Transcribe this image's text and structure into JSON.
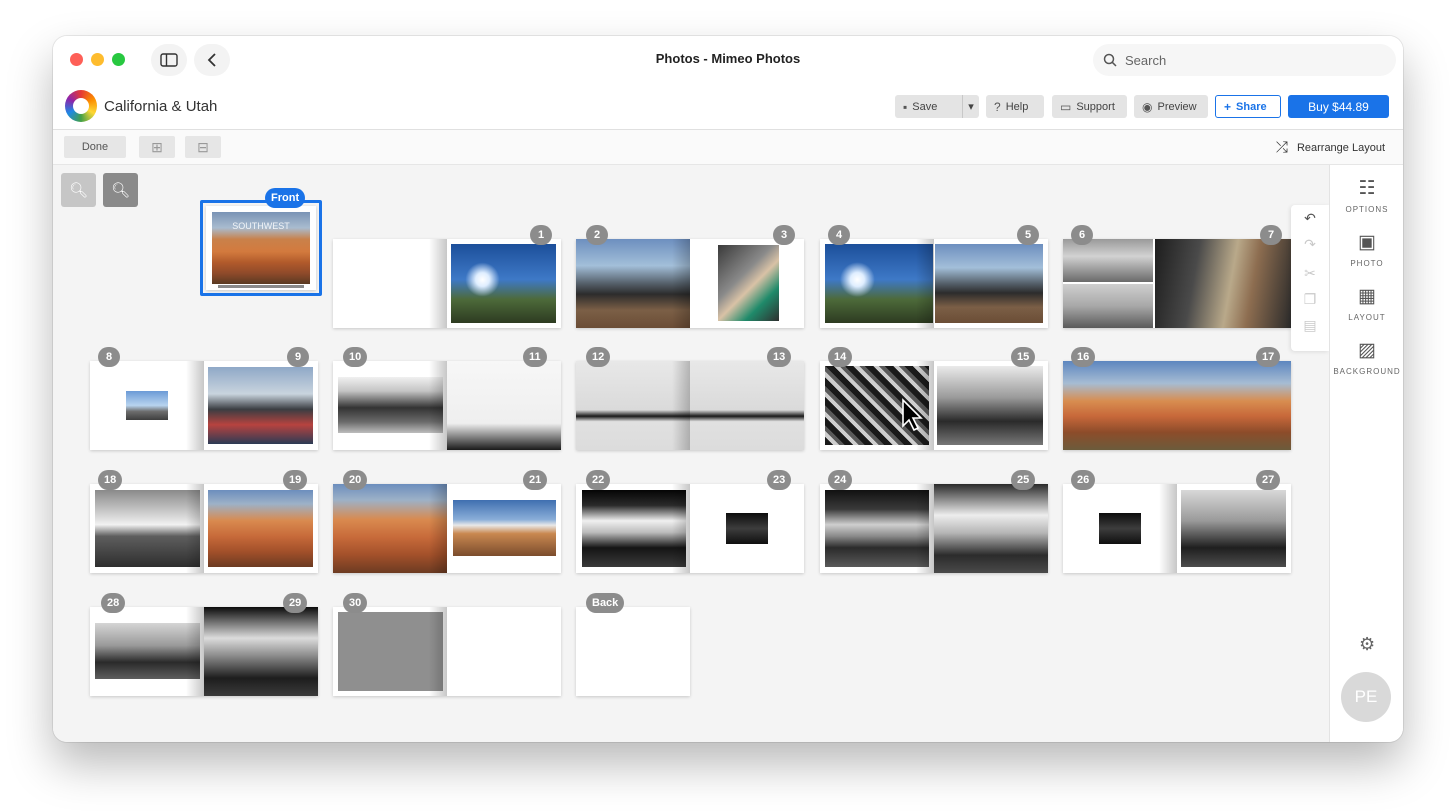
{
  "window": {
    "title": "Photos - Mimeo Photos"
  },
  "search": {
    "placeholder": "Search"
  },
  "project": {
    "name": "California & Utah"
  },
  "header_buttons": {
    "save": "Save",
    "help": "Help",
    "support": "Support",
    "preview": "Preview",
    "share": "Share",
    "buy": "Buy $44.89"
  },
  "toolbar": {
    "done": "Done",
    "rearrange": "Rearrange Layout"
  },
  "pages": {
    "front": "Front",
    "back": "Back",
    "numbers": [
      "1",
      "2",
      "3",
      "4",
      "5",
      "6",
      "7",
      "8",
      "9",
      "10",
      "11",
      "12",
      "13",
      "14",
      "15",
      "16",
      "17",
      "18",
      "19",
      "20",
      "21",
      "22",
      "23",
      "24",
      "25",
      "26",
      "27",
      "28",
      "29",
      "30"
    ]
  },
  "cover_text": "SOUTHWEST",
  "rail": {
    "options": "OPTIONS",
    "photo": "PHOTO",
    "layout": "LAYOUT",
    "background": "BACKGROUND"
  },
  "avatar": {
    "initials": "PE"
  },
  "icons": {
    "search": "search-icon",
    "sidebar": "sidebar-toggle-icon",
    "back": "chevron-left-icon",
    "zoom_out": "zoom-out-icon",
    "zoom_in": "zoom-in-icon",
    "undo": "undo-icon",
    "redo": "redo-icon",
    "cut": "scissors-icon",
    "copy": "copy-icon",
    "paste": "paste-icon",
    "settings": "gear-icon"
  },
  "colors": {
    "accent": "#1a73e8",
    "badge": "#8c8c8c",
    "canvas": "#f4f4f4"
  }
}
